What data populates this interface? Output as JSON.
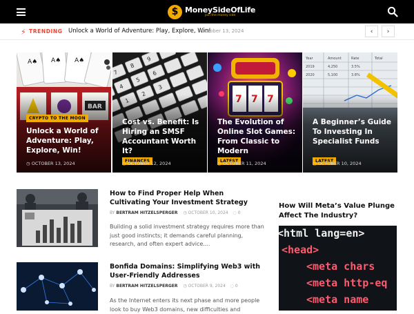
{
  "header": {
    "logo_symbol": "$",
    "logo_name": "MoneySideOfLife",
    "logo_tagline": "join the money side",
    "menu_icon": "hamburger-menu-icon",
    "search_icon": "search-icon"
  },
  "trending": {
    "label": "TRENDING",
    "icon": "lightning-icon",
    "headline": "Unlock a World of Adventure: Play, Explore, Win!",
    "date": "October 13, 2024",
    "prev": "‹",
    "next": "›"
  },
  "hero": [
    {
      "category": "CRYPTO TO THE MOON",
      "title": "Unlock a World of Adventure: Play, Explore, Win!",
      "date": "OCTOBER 13, 2024"
    },
    {
      "category": "FINANCES",
      "title": "Cost vs. Benefit: Is Hiring an SMSF Accountant Worth It?",
      "date": "OCTOBER 12, 2024"
    },
    {
      "category": "LATEST",
      "title": "The Evolution of Online Slot Games: From Classic to Modern",
      "date": "OCTOBER 11, 2024"
    },
    {
      "category": "LATEST",
      "title": "A Beginner’s Guide To Investing In Specialist Funds",
      "date": "OCTOBER 10, 2024"
    }
  ],
  "articles": [
    {
      "title": "How to Find Proper Help When Cultivating Your Investment Strategy",
      "by": "BY",
      "author": "BERTRAM HITZELSPERGER",
      "date": "OCTOBER 10, 2024",
      "comments": "0",
      "excerpt": "Building a solid investment strategy requires more than just good instincts; it demands careful planning, research, and often expert advice...."
    },
    {
      "title": "Bonfida Domains: Simplifying Web3 with User-Friendly Addresses",
      "by": "BY",
      "author": "BERTRAM HITZELSPERGER",
      "date": "OCTOBER 9, 2024",
      "comments": "0",
      "excerpt": "As the Internet enters its next phase and more people look to buy Web3 domains, new difficulties and"
    }
  ],
  "sidebar": {
    "title": "How Will Meta’s Value Plunge Affect The Industry?",
    "code_lines": [
      "<html lang=en>",
      "<head>",
      "<meta chars",
      "<meta http-eq",
      "<meta name"
    ]
  },
  "colors": {
    "accent": "#f2a900",
    "trending": "#f2412e",
    "topbar": "#000000"
  }
}
